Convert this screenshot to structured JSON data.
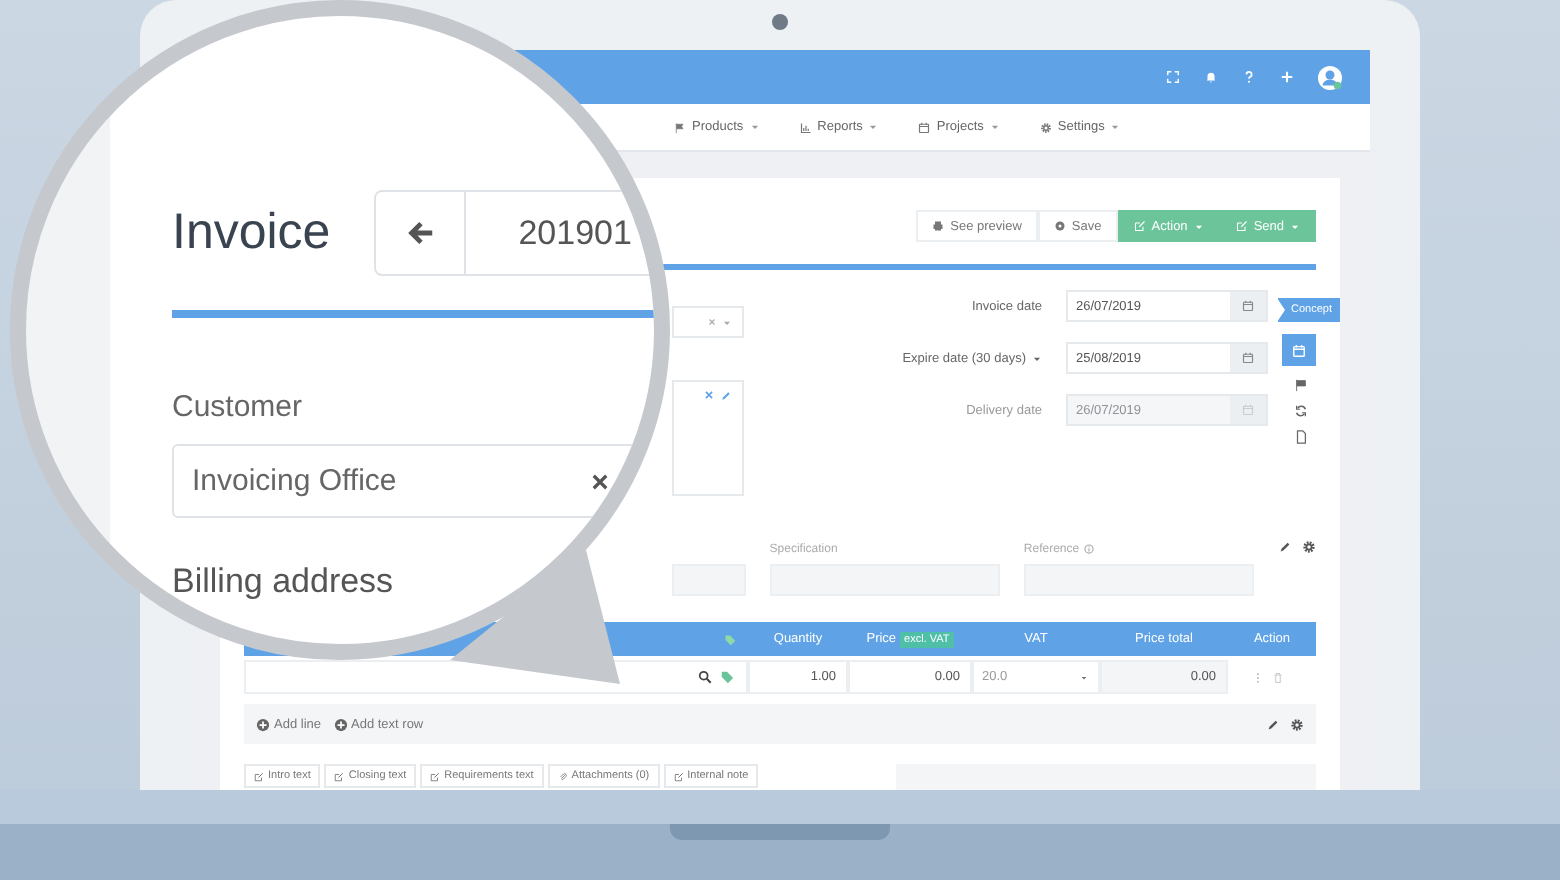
{
  "magnifier": {
    "title": "Invoice",
    "number": "201901",
    "customer_label": "Customer",
    "customer_value": "Invoicing Office",
    "billing_label": "Billing address"
  },
  "nav_items": [
    "Products",
    "Reports",
    "Projects",
    "Settings"
  ],
  "toolbar": [
    {
      "label": "See preview",
      "kind": "plain"
    },
    {
      "label": "Save",
      "kind": "plain"
    },
    {
      "label": "Action",
      "kind": "primary"
    },
    {
      "label": "Send",
      "kind": "primary"
    }
  ],
  "dates": [
    {
      "label": "Invoice date",
      "value": "26/07/2019",
      "disabled": false,
      "dropdown": false
    },
    {
      "label": "Expire date (30 days)",
      "value": "25/08/2019",
      "disabled": false,
      "dropdown": true
    },
    {
      "label": "Delivery date",
      "value": "26/07/2019",
      "disabled": true,
      "dropdown": false
    }
  ],
  "status_ribbon": "Concept",
  "fields": [
    {
      "label": "Specification",
      "info": false
    },
    {
      "label": "Reference",
      "info": true
    }
  ],
  "table": {
    "columns": [
      {
        "label": "Quantity"
      },
      {
        "label": "Price",
        "badge": "excl. VAT"
      },
      {
        "label": "VAT"
      },
      {
        "label": "Price total"
      },
      {
        "label": "Action"
      }
    ],
    "rows": [
      {
        "quantity": "1.00",
        "price": "0.00",
        "vat": "20.0",
        "total": "0.00"
      }
    ]
  },
  "add_actions": [
    "Add line",
    "Add text row"
  ],
  "tabs": [
    "Intro text",
    "Closing text",
    "Requirements text",
    "Attachments (0)",
    "Internal note"
  ]
}
